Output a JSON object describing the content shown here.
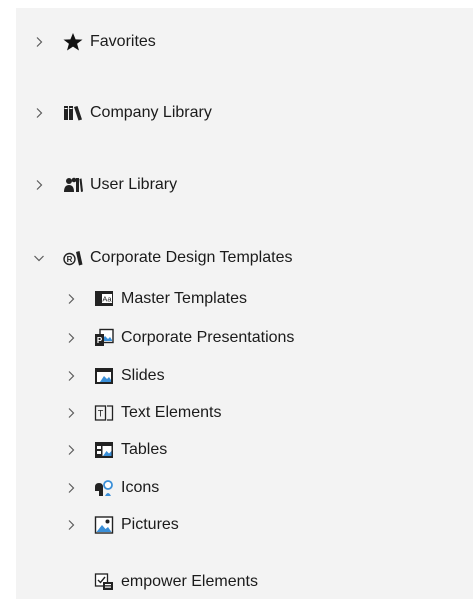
{
  "tree": {
    "favorites": {
      "label": "Favorites",
      "icon": "star-icon"
    },
    "company_library": {
      "label": "Company Library",
      "icon": "books-icon"
    },
    "user_library": {
      "label": "User Library",
      "icon": "users-books-icon"
    },
    "corporate_design_templates": {
      "label": "Corporate Design Templates",
      "icon": "registered-book-icon",
      "expanded": true,
      "children": [
        {
          "label": "Master Templates",
          "icon": "master-template-icon"
        },
        {
          "label": "Corporate Presentations",
          "icon": "presentation-icon"
        },
        {
          "label": "Slides",
          "icon": "slide-icon"
        },
        {
          "label": "Text Elements",
          "icon": "text-element-icon"
        },
        {
          "label": "Tables",
          "icon": "table-icon"
        },
        {
          "label": "Icons",
          "icon": "icons-icon"
        },
        {
          "label": "Pictures",
          "icon": "picture-icon"
        },
        {
          "label": "empower Elements",
          "icon": "empower-elements-icon"
        }
      ]
    }
  }
}
